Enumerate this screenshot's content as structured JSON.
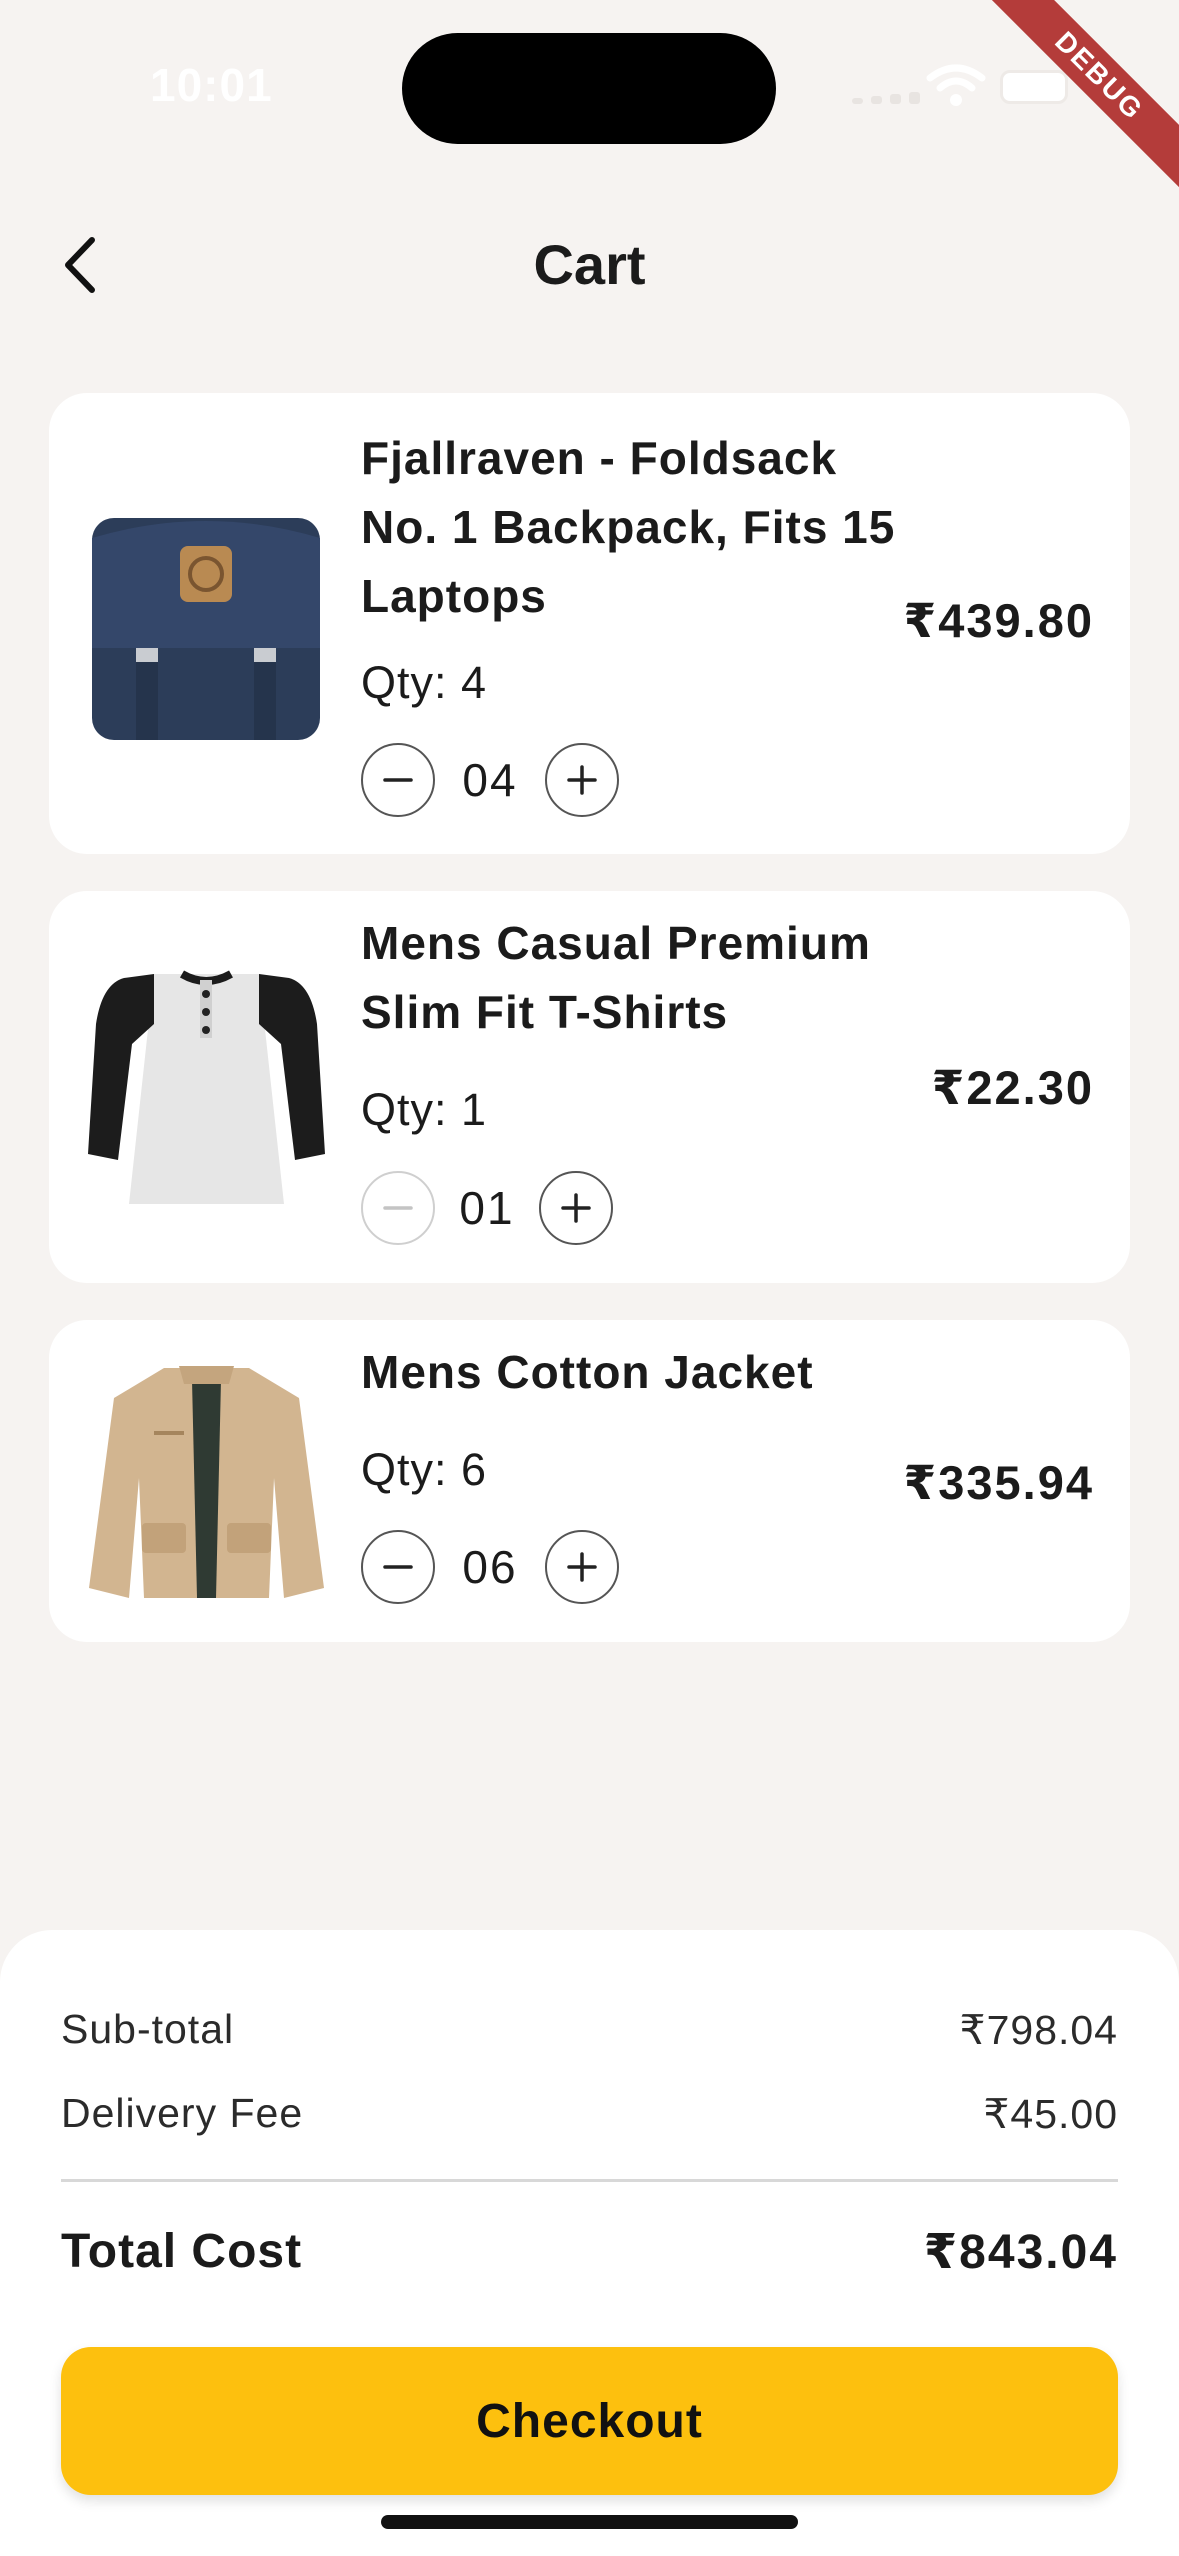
{
  "status_bar": {
    "time": "10:01",
    "debug_label": "DEBUG"
  },
  "header": {
    "title": "Cart",
    "back_icon": "chevron-left-icon"
  },
  "cart_items": [
    {
      "title": "Fjallraven - Foldsack No. 1 Backpack, Fits 15 Laptops",
      "qty_label": "Qty: 4",
      "qty_value": "04",
      "price": "₹439.80",
      "decrement_enabled": true
    },
    {
      "title": "Mens Casual Premium Slim Fit T-Shirts",
      "qty_label": "Qty: 1",
      "qty_value": "01",
      "price": "₹22.30",
      "decrement_enabled": false
    },
    {
      "title": "Mens Cotton Jacket",
      "qty_label": "Qty: 6",
      "qty_value": "06",
      "price": "₹335.94",
      "decrement_enabled": true
    }
  ],
  "summary": {
    "subtotal_label": "Sub-total",
    "subtotal_value": "₹798.04",
    "delivery_label": "Delivery Fee",
    "delivery_value": "₹45.00",
    "total_label": "Total Cost",
    "total_value": "₹843.04",
    "checkout_label": "Checkout"
  },
  "colors": {
    "background": "#f6f3f1",
    "accent": "#fdc00e",
    "card": "#ffffff",
    "debug": "#b43c3a"
  }
}
